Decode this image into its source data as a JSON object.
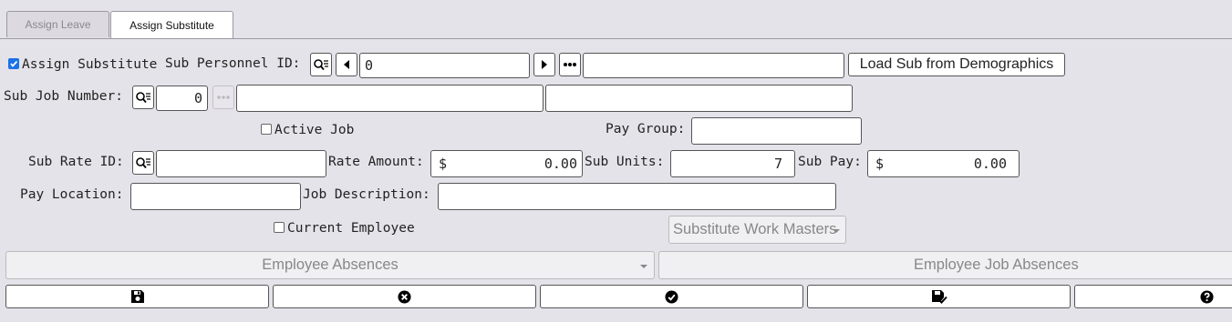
{
  "tabs": [
    {
      "label": "Assign Leave",
      "active": false
    },
    {
      "label": "Assign Substitute",
      "active": true
    }
  ],
  "form": {
    "assign_substitute": {
      "label": "Assign Substitute",
      "checked": true
    },
    "sub_personnel_id": {
      "label": "Sub Personnel ID:",
      "value": "0",
      "name_value": ""
    },
    "load_button": "Load Sub from Demographics",
    "sub_job_number": {
      "label": "Sub Job Number:",
      "value": "0",
      "desc1": "",
      "desc2": ""
    },
    "active_job": {
      "label": "Active Job",
      "checked": false
    },
    "pay_group": {
      "label": "Pay Group:",
      "value": ""
    },
    "sub_rate_id": {
      "label": "Sub Rate ID:",
      "value": ""
    },
    "rate_amount": {
      "label": "Rate Amount:",
      "currency": "$",
      "value": "0.00"
    },
    "sub_units": {
      "label": "Sub Units:",
      "value": "7"
    },
    "sub_pay": {
      "label": "Sub Pay:",
      "currency": "$",
      "value": "0.00"
    },
    "pay_location": {
      "label": "Pay Location:",
      "value": ""
    },
    "job_description": {
      "label": "Job Description:",
      "value": ""
    },
    "current_employee": {
      "label": "Current Employee",
      "checked": false
    },
    "substitute_work_masters": "Substitute Work Masters"
  },
  "lower": {
    "employee_absences": "Employee Absences",
    "employee_job_absences": "Employee Job Absences"
  },
  "toolbar": {
    "icons": [
      "save-icon",
      "cancel-icon",
      "confirm-icon",
      "save-check-icon",
      "help-icon"
    ]
  }
}
